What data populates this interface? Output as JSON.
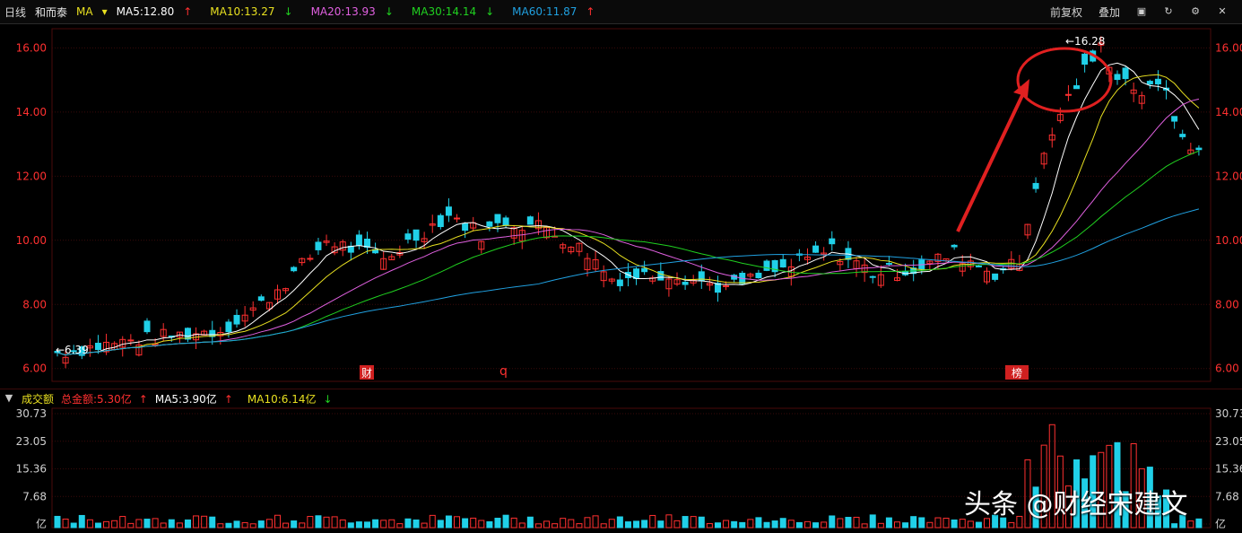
{
  "header": {
    "period": "日线",
    "stock_name": "和而泰",
    "indicator": "MA",
    "ma": [
      {
        "label": "MA5:12.80",
        "dir": "↑",
        "color": "#ffffff"
      },
      {
        "label": "MA10:13.27",
        "dir": "↓",
        "color": "#e8e020"
      },
      {
        "label": "MA20:13.93",
        "dir": "↓",
        "color": "#e060e0"
      },
      {
        "label": "MA30:14.14",
        "dir": "↓",
        "color": "#20d020"
      },
      {
        "label": "MA60:11.87",
        "dir": "↑",
        "color": "#20a0e0"
      }
    ],
    "tools": {
      "adjust": "前复权",
      "overlay": "叠加"
    }
  },
  "price_axis": [
    "16.00",
    "14.00",
    "12.00",
    "10.00",
    "8.00",
    "6.00"
  ],
  "annotations": {
    "high": "←16.28",
    "low": "←6.39",
    "event1": "财",
    "event2": "q",
    "event3": "榜"
  },
  "volume": {
    "title": "成交额",
    "total": "总金额:5.30亿",
    "ma5": "MA5:3.90亿",
    "ma10": "MA10:6.14亿",
    "axis": [
      "30.73",
      "23.05",
      "15.36",
      "7.68",
      "亿"
    ]
  },
  "watermark": "头条 @财经宋建文",
  "colors": {
    "up": "#ff3030",
    "down": "#20d0e8",
    "grid": "#3a0a0a"
  },
  "chart_data": {
    "type": "candlestick",
    "y_range": [
      5.6,
      16.6
    ],
    "count": 130,
    "keypoints": [
      [
        0,
        6.5
      ],
      [
        10,
        6.9
      ],
      [
        20,
        7.2
      ],
      [
        25,
        8.0
      ],
      [
        30,
        9.2
      ],
      [
        33,
        10.0
      ],
      [
        40,
        9.4
      ],
      [
        45,
        10.3
      ],
      [
        48,
        10.8
      ],
      [
        52,
        10.2
      ],
      [
        55,
        10.6
      ],
      [
        60,
        10.4
      ],
      [
        65,
        9.6
      ],
      [
        68,
        8.8
      ],
      [
        75,
        9.0
      ],
      [
        82,
        8.5
      ],
      [
        88,
        9.0
      ],
      [
        95,
        9.7
      ],
      [
        100,
        9.0
      ],
      [
        105,
        9.1
      ],
      [
        110,
        9.6
      ],
      [
        115,
        9.0
      ],
      [
        118,
        9.3
      ],
      [
        120,
        11.8
      ],
      [
        123,
        14.0
      ],
      [
        126,
        15.3
      ],
      [
        128,
        16.0
      ],
      [
        130,
        15.2
      ],
      [
        133,
        14.6
      ],
      [
        136,
        14.8
      ],
      [
        138,
        13.0
      ],
      [
        140,
        12.8
      ]
    ]
  }
}
